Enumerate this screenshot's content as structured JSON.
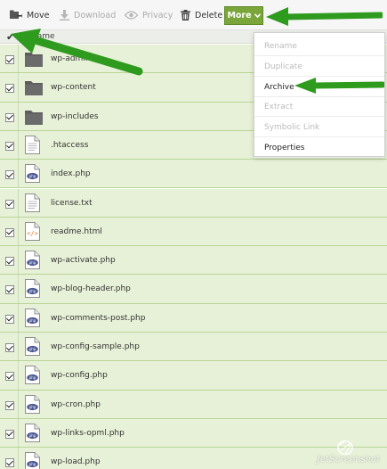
{
  "toolbar": {
    "move_label": "Move",
    "download_label": "Download",
    "privacy_label": "Privacy",
    "delete_label": "Delete",
    "more_label": "More"
  },
  "header": {
    "name_label": "Name"
  },
  "files": [
    {
      "name": "wp-admin",
      "type": "folder",
      "checked": true
    },
    {
      "name": "wp-content",
      "type": "folder",
      "checked": true
    },
    {
      "name": "wp-includes",
      "type": "folder",
      "checked": true
    },
    {
      "name": ".htaccess",
      "type": "text",
      "checked": true
    },
    {
      "name": "index.php",
      "type": "php",
      "checked": true
    },
    {
      "name": "license.txt",
      "type": "text",
      "checked": true
    },
    {
      "name": "readme.html",
      "type": "html",
      "checked": true
    },
    {
      "name": "wp-activate.php",
      "type": "php",
      "checked": true
    },
    {
      "name": "wp-blog-header.php",
      "type": "php",
      "checked": true
    },
    {
      "name": "wp-comments-post.php",
      "type": "php",
      "checked": true
    },
    {
      "name": "wp-config-sample.php",
      "type": "php",
      "checked": true
    },
    {
      "name": "wp-config.php",
      "type": "php",
      "checked": true
    },
    {
      "name": "wp-cron.php",
      "type": "php",
      "checked": true
    },
    {
      "name": "wp-links-opml.php",
      "type": "php",
      "checked": true
    },
    {
      "name": "wp-load.php",
      "type": "php",
      "checked": true
    }
  ],
  "dropdown": {
    "items": [
      {
        "label": "Rename",
        "enabled": false
      },
      {
        "label": "Duplicate",
        "enabled": false
      },
      {
        "label": "Archive",
        "enabled": true
      },
      {
        "label": "Extract",
        "enabled": false
      },
      {
        "label": "Symbolic Link",
        "enabled": false
      },
      {
        "label": "Properties",
        "enabled": true
      }
    ]
  },
  "colors": {
    "row_selected": "#e7f1d7",
    "more_button": "#7aa53a",
    "arrow": "#2e9a1e"
  },
  "watermark": {
    "text": "JetScreenshot"
  }
}
